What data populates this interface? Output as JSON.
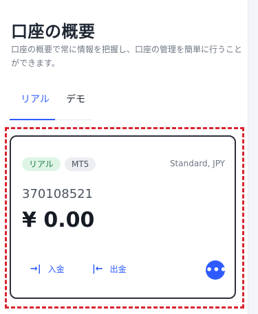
{
  "header": {
    "title": "口座の概要",
    "subtitle": "口座の概要で常に情報を把握し、口座の管理を簡単に行うことができます。"
  },
  "tabs": [
    {
      "label": "リアル",
      "active": true
    },
    {
      "label": "デモ",
      "active": false
    }
  ],
  "account_card": {
    "badges": [
      "リアル",
      "MT5"
    ],
    "account_type": "Standard, JPY",
    "account_number": "370108521",
    "balance": "¥ 0.00",
    "actions": {
      "deposit_label": "入金",
      "withdraw_label": "出金",
      "deposit_icon": "→|",
      "withdraw_icon": "|←"
    },
    "more_icon": "•••"
  },
  "colors": {
    "accent": "#2e5bff",
    "highlight": "#d9232e",
    "badge_green_bg": "#def5e6",
    "badge_green_text": "#1e7a46"
  }
}
